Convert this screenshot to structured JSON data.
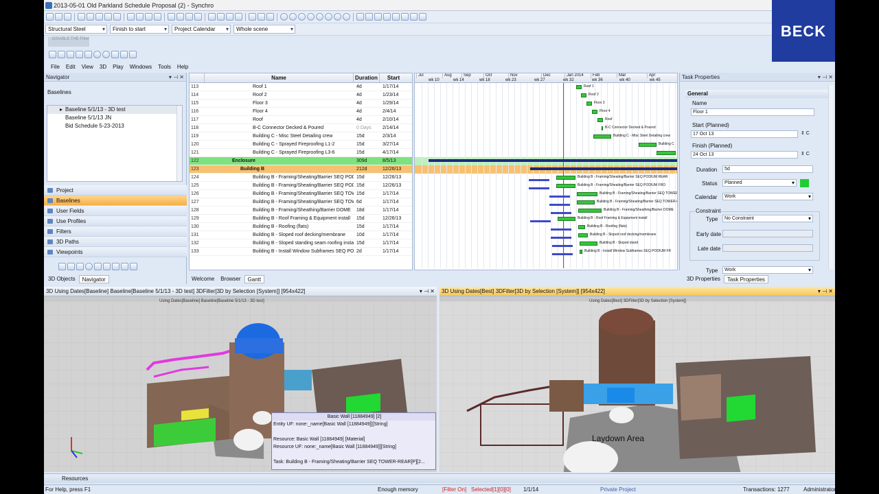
{
  "window": {
    "title": "2013-05-01 Old Parkland Schedule Proposal (2) - Synchro"
  },
  "brand": {
    "logo": "BECK"
  },
  "toolbar": {
    "combo1": "Structural Steel",
    "combo2": "Finish to start",
    "combo3": "Project Calendar",
    "combo4": "Whole scene",
    "filter_label": "DISABLE THE Filter"
  },
  "menu": [
    "File",
    "Edit",
    "View",
    "3D",
    "Play",
    "Windows",
    "Tools",
    "Help"
  ],
  "navigator": {
    "title": "Navigator",
    "section": "Baselines",
    "baselines": [
      "Baseline 5/1/13 - 3D test",
      "Baseline 5/1/13 JN",
      "Bid Schedule 5-23-2013"
    ],
    "items": [
      "Project",
      "Baselines",
      "User Fields",
      "Use Profiles",
      "Filters",
      "3D Paths",
      "Viewpoints"
    ],
    "tabs": [
      "3D Objects",
      "Navigator"
    ]
  },
  "grid": {
    "headers": [
      "Name",
      "Duration",
      "Start"
    ],
    "rows": [
      {
        "id": "113",
        "name": "Roof 1",
        "dur": "4d",
        "start": "1/17/14"
      },
      {
        "id": "114",
        "name": "Roof 2",
        "dur": "4d",
        "start": "1/23/14"
      },
      {
        "id": "115",
        "name": "Floor 3",
        "dur": "4d",
        "start": "1/29/14"
      },
      {
        "id": "116",
        "name": "Floor 4",
        "dur": "4d",
        "start": "2/4/14"
      },
      {
        "id": "117",
        "name": "Roof",
        "dur": "4d",
        "start": "2/10/14"
      },
      {
        "id": "118",
        "name": "B-C Connector Decked & Poured",
        "dur": "0 Days",
        "start": "2/14/14"
      },
      {
        "id": "119",
        "name": "Building C - Misc Steel Detailing crew",
        "dur": "15d",
        "start": "2/3/14"
      },
      {
        "id": "120",
        "name": "Building C - Sprayed Fireproofing L1-2",
        "dur": "15d",
        "start": "3/27/14"
      },
      {
        "id": "121",
        "name": "Building C - Sprayed Fireproofing L3-6",
        "dur": "15d",
        "start": "4/17/14"
      },
      {
        "id": "122",
        "name": "Enclosure",
        "dur": "309d",
        "start": "8/5/13"
      },
      {
        "id": "123",
        "name": "Building B",
        "dur": "212d",
        "start": "12/26/13"
      },
      {
        "id": "124",
        "name": "Building B - Framing/Sheating/Barrier SEQ PODIUM R...",
        "dur": "15d",
        "start": "12/26/13"
      },
      {
        "id": "125",
        "name": "Building B - Framing/Sheating/Barrier SEQ PODIUM F...",
        "dur": "15d",
        "start": "12/26/13"
      },
      {
        "id": "126",
        "name": "Building B - Framing/Sheating/Barrier SEQ TOWER R...",
        "dur": "15d",
        "start": "1/17/14"
      },
      {
        "id": "127",
        "name": "Building B - Framing/Sheating/Barrier SEQ TOWER F...",
        "dur": "6d",
        "start": "1/17/14"
      },
      {
        "id": "128",
        "name": "Building B - Framing/Sheathing/Barrier DOME",
        "dur": "18d",
        "start": "1/17/14"
      },
      {
        "id": "129",
        "name": "Building B - Roof Framing & Equipment install",
        "dur": "15d",
        "start": "12/26/13"
      },
      {
        "id": "130",
        "name": "Building B - Roofing (flats)",
        "dur": "15d",
        "start": "1/17/14"
      },
      {
        "id": "131",
        "name": "Building B - Sloped roof decking/membrane",
        "dur": "10d",
        "start": "1/17/14"
      },
      {
        "id": "132",
        "name": "Building B - Sloped standing seam roofing installations",
        "dur": "15d",
        "start": "1/17/14"
      },
      {
        "id": "133",
        "name": "Building B - Install Window Subframes SEQ PODIUM F...",
        "dur": "2d",
        "start": "1/17/14"
      }
    ]
  },
  "gantt": {
    "months": [
      "Jul",
      "Aug",
      "Sep",
      "Oct",
      "Nov",
      "Dec",
      "Jan 2014",
      "Feb",
      "Mar",
      "Apr"
    ],
    "weeks": [
      "wk 10",
      "wk 14",
      "wk 18",
      "wk 23",
      "wk 27",
      "wk 32",
      "wk 36",
      "wk 40",
      "wk 45"
    ],
    "labels": [
      "Roof 1",
      "Roof 2",
      "Floor 3",
      "Floor 4",
      "Roof",
      "B-C Connector Decked & Poured",
      "Building C - Misc Steel Detailing crew",
      "Building C",
      "Building B - Framing/Sheating/Barrier SEQ PODIUM REAR",
      "Building B - Framing/Sheating/Barrier SEQ PODIUM FRO",
      "Building B - Framing/Sheating/Barrier SEQ TOWER-REAR",
      "Building B - Framing/Sheating/Barrier SEQ TOWER-FR",
      "Building B - Framing/Sheathing/Barrier DOME",
      "Building B - Roof Framing & Equipment install",
      "Building B - Roofing (flats)",
      "Building B - Sloped roof decking/membrane",
      "Building B - Sloped stand",
      "Building B - Install Window Subframes SEQ PODIUM FR"
    ]
  },
  "center_tabs": [
    "Welcome",
    "Browser",
    "Gantt"
  ],
  "task_properties": {
    "title": "Task Properties",
    "group": "General",
    "name_label": "Name",
    "name_value": "Floor 1",
    "start_label": "Start (Planned)",
    "start_value": "17 Oct 13",
    "finish_label": "Finish (Planned)",
    "finish_value": "24 Oct 13",
    "duration_label": "Duration",
    "duration_value": "5d",
    "status_label": "Status",
    "status_value": "Planned",
    "calendar_label": "Calendar",
    "calendar_value": "Work",
    "constraint_group": "Constraint",
    "type_label": "Type",
    "type_value": "No Constraint",
    "early_label": "Early date",
    "late_label": "Late date",
    "type2_value": "Work",
    "tabs": [
      "3D Properties",
      "Task Properties"
    ],
    "status_color": "#22cc33"
  },
  "viewport_left": {
    "header": "3D Using Dates[Baseline] Baseline[Baseline 5/1/13 - 3D test] 3DFilter[3D by Selection [System]] [954x422]",
    "caption": "Using Dates[Baseline] Baseline[Baseline 5/1/13 - 3D test]"
  },
  "viewport_right": {
    "header": "3D Using Dates[Best] 3DFilter[3D by Selection [System]] [954x422]",
    "caption": "Using Dates[Best] 3DFilter[3D by Selection [System]]",
    "laydown": "Laydown Area"
  },
  "tooltip": {
    "title": "Basic Wall [11884949] [2]",
    "entity": "Entity UF: none:_name[Basic Wall [11884949]][String]",
    "resource": "Resource: Basic Wall [11884949] [Material]",
    "resource_uf": "Resource UF: none:_name[Basic Wall [11884949]][String]",
    "task": "Task: Building B - Framing/Sheating/Barrier SEQ TOWER-REAR[P][2..."
  },
  "resources_tab": "Resources",
  "status": {
    "help": "For Help, press F1",
    "memory": "Enough memory",
    "filter": "[Filter On]",
    "selected": "Selected[1][0][0]",
    "date": "1/1/14",
    "project": "Private Project",
    "transactions": "Transactions: 1277",
    "user": "Administrator"
  }
}
